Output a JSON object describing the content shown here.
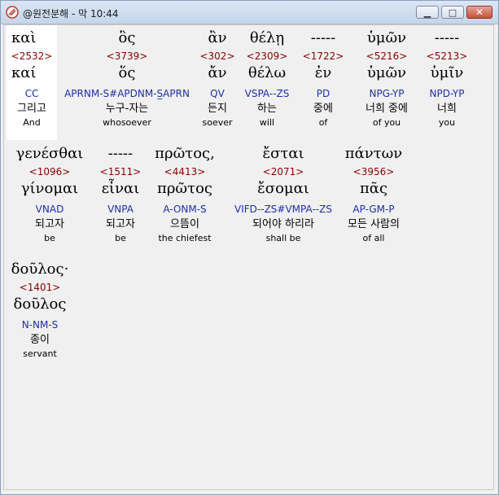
{
  "window": {
    "title": "@원전분해 - 막 10:44",
    "controls": {
      "minimize_icon": "minimize-icon",
      "maximize_icon": "maximize-icon",
      "close_icon": "close-icon"
    }
  },
  "rows": [
    {
      "words": [
        {
          "greek": "καὶ",
          "strong": "<2532>",
          "lemma": "καί",
          "morph": "CC",
          "korean": "그리고",
          "english": "And"
        },
        {
          "greek": "ὃς",
          "strong": "<3739>",
          "lemma": "ὅς",
          "morph": "APRNM-S#APDNM-S̲APRN",
          "korean": "누구-자는",
          "english": "whosoever"
        },
        {
          "greek": "ἂν",
          "strong": "<302>",
          "lemma": "ἄν",
          "morph": "QV",
          "korean": "든지",
          "english": "soever"
        },
        {
          "greek": "θέλῃ",
          "strong": "<2309>",
          "lemma": "θέλω",
          "morph": "VSPA--ZS",
          "korean": "하는",
          "english": "will"
        },
        {
          "greek": "-----",
          "strong": "<1722>",
          "lemma": "ἐν",
          "morph": "PD",
          "korean": "중에",
          "english": "of"
        },
        {
          "greek": "ὑμῶν",
          "strong": "<5216>",
          "lemma": "ὑμῶν",
          "morph": "NPG-YP",
          "korean": "너희 중에",
          "english": "of you"
        },
        {
          "greek": "-----",
          "strong": "<5213>",
          "lemma": "ὑμῖν",
          "morph": "NPD-YP",
          "korean": "너희",
          "english": "you"
        }
      ]
    },
    {
      "words": [
        {
          "greek": "γενέσθαι",
          "strong": "<1096>",
          "lemma": "γίνομαι",
          "morph": "VNAD",
          "korean": "되고자",
          "english": "be"
        },
        {
          "greek": "-----",
          "strong": "<1511>",
          "lemma": "εἶναι",
          "morph": "VNPA",
          "korean": "되고자",
          "english": "be"
        },
        {
          "greek": "πρῶτος,",
          "strong": "<4413>",
          "lemma": "πρῶτος",
          "morph": "A-ONM-S",
          "korean": "으뜸이",
          "english": "the chiefest"
        },
        {
          "greek": "ἔσται",
          "strong": "<2071>",
          "lemma": "ἔσομαι",
          "morph": "VIFD--ZS#VMPA--ZS",
          "korean": "되어야 하리라",
          "english": "shall be"
        },
        {
          "greek": "πάντων",
          "strong": "<3956>",
          "lemma": "πᾶς",
          "morph": "AP-GM-P",
          "korean": "모든 사람의",
          "english": "of all"
        }
      ]
    },
    {
      "words": [
        {
          "greek": "δοῦλος·",
          "strong": "<1401>",
          "lemma": "δοῦλος",
          "morph": "N-NM-S",
          "korean": "종이",
          "english": "servant"
        }
      ]
    }
  ]
}
